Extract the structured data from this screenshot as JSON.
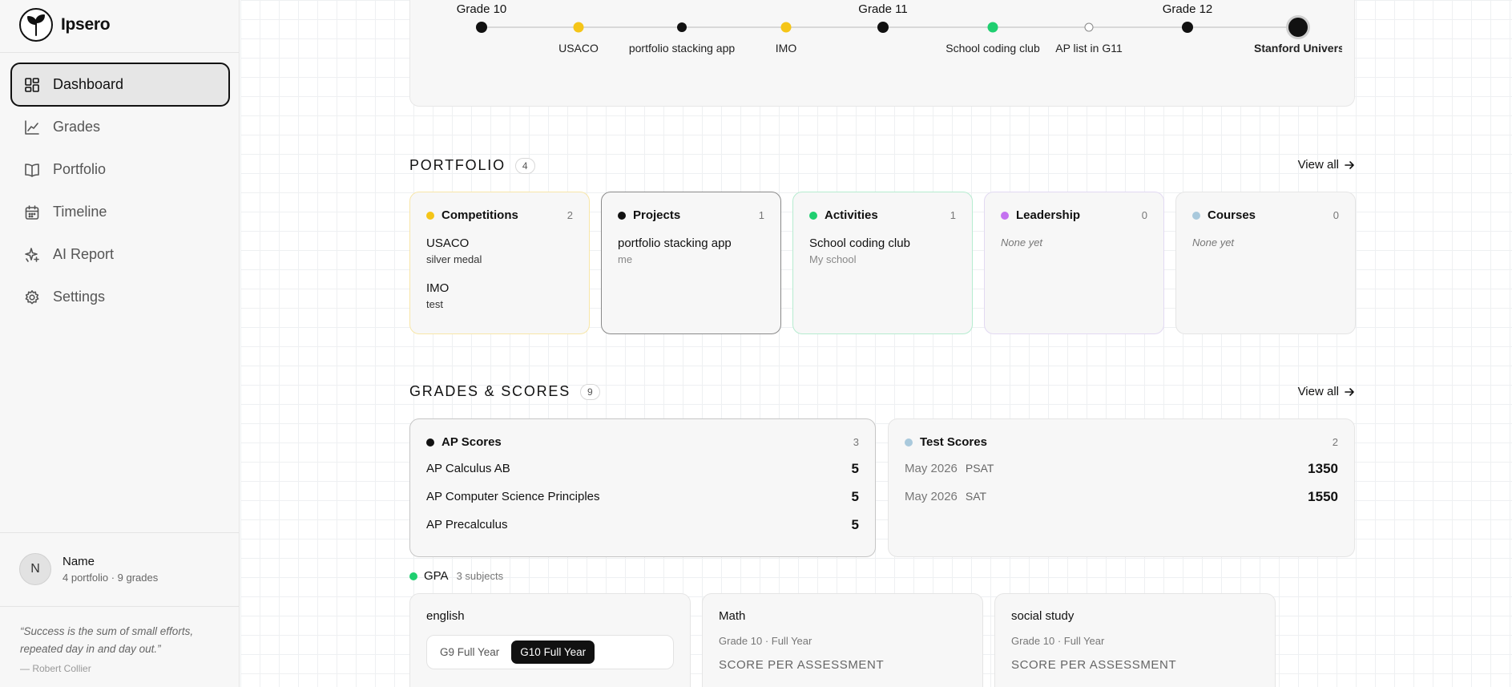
{
  "brand": {
    "name": "Ipsero"
  },
  "nav": [
    {
      "label": "Dashboard",
      "icon": "dashboard-icon",
      "active": true
    },
    {
      "label": "Grades",
      "icon": "chart-line-icon"
    },
    {
      "label": "Portfolio",
      "icon": "book-open-icon"
    },
    {
      "label": "Timeline",
      "icon": "calendar-icon"
    },
    {
      "label": "AI Report",
      "icon": "sparkles-icon"
    },
    {
      "label": "Settings",
      "icon": "gear-icon"
    }
  ],
  "profile": {
    "initial": "N",
    "name": "Name",
    "meta": "4 portfolio · 9 grades"
  },
  "quote": {
    "text": "“Success is the sum of small efforts, repeated day in and day out.”",
    "author": "— Robert Collier"
  },
  "timeline": {
    "grades": [
      "Grade 10",
      "Grade 11",
      "Grade 12"
    ],
    "events": [
      {
        "label": "USACO",
        "color": "#f5c518"
      },
      {
        "label": "portfolio stacking app",
        "color": "#111111"
      },
      {
        "label": "IMO",
        "color": "#f5c518"
      },
      {
        "label": "School coding club",
        "color": "#1fcf70"
      },
      {
        "label": "AP list in G11",
        "color": "#ffffff"
      },
      {
        "label": "Stanford Universi",
        "color": "#111111"
      }
    ]
  },
  "portfolio": {
    "title": "PORTFOLIO",
    "count": "4",
    "view_all": "View all",
    "cards": [
      {
        "name": "Competitions",
        "count": "2",
        "dot": "#f5c518",
        "border": "#f7e6a8",
        "items": [
          {
            "title": "USACO",
            "sub": "silver medal"
          },
          {
            "title": "IMO",
            "sub": "test"
          }
        ]
      },
      {
        "name": "Projects",
        "count": "1",
        "dot": "#111111",
        "border": "#8a8a8a",
        "items": [
          {
            "title": "portfolio stacking app",
            "sub": "me"
          }
        ]
      },
      {
        "name": "Activities",
        "count": "1",
        "dot": "#1fcf70",
        "border": "#b6ecd0",
        "items": [
          {
            "title": "School coding club",
            "sub": "My school"
          }
        ]
      },
      {
        "name": "Leadership",
        "count": "0",
        "dot": "#c472f0",
        "border": "#e2d9f2",
        "none": "None yet",
        "items": []
      },
      {
        "name": "Courses",
        "count": "0",
        "dot": "#a9c9dc",
        "border": "#e5e5e5",
        "none": "None yet",
        "items": []
      }
    ]
  },
  "grades": {
    "title": "GRADES & SCORES",
    "count": "9",
    "view_all": "View all",
    "ap": {
      "name": "AP Scores",
      "count": "3",
      "dot": "#111111",
      "rows": [
        {
          "subject": "AP Calculus AB",
          "score": "5"
        },
        {
          "subject": "AP Computer Science Principles",
          "score": "5"
        },
        {
          "subject": "AP Precalculus",
          "score": "5"
        }
      ]
    },
    "tests": {
      "name": "Test Scores",
      "count": "2",
      "dot": "#a9c9dc",
      "rows": [
        {
          "date": "May 2026",
          "test": "PSAT",
          "score": "1350"
        },
        {
          "date": "May 2026",
          "test": "SAT",
          "score": "1550"
        }
      ]
    }
  },
  "gpa": {
    "label": "GPA",
    "subjects_count": "3 subjects",
    "dot": "#1fcf70",
    "cards": [
      {
        "title": "english",
        "tabs": [
          "G9 Full Year",
          "G10 Full Year"
        ],
        "active_tab": "G10 Full Year"
      },
      {
        "title": "Math",
        "sub": "Grade 10 · Full Year",
        "score_label": "SCORE PER ASSESSMENT"
      },
      {
        "title": "social study",
        "sub": "Grade 10 · Full Year",
        "score_label": "SCORE PER ASSESSMENT"
      }
    ]
  }
}
